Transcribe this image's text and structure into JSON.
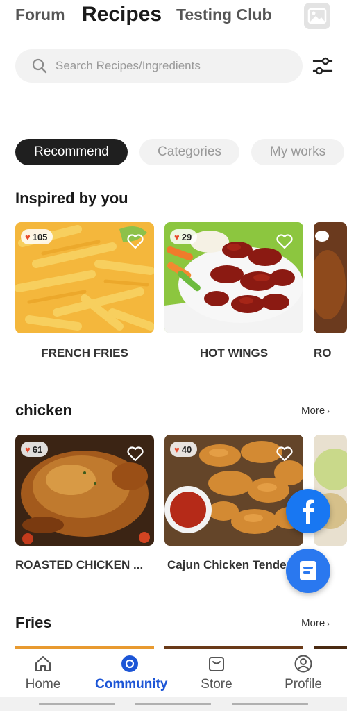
{
  "top_tabs": [
    "Forum",
    "Recipes",
    "Testing Club"
  ],
  "search": {
    "placeholder": "Search Recipes/Ingredients"
  },
  "filter_pills": [
    "Recommend",
    "Categories",
    "My works"
  ],
  "sections": [
    {
      "title": "Inspired by you",
      "items": [
        {
          "label": "FRENCH FRIES",
          "likes": "105"
        },
        {
          "label": "HOT WINGS",
          "likes": "29"
        },
        {
          "label": "RO"
        }
      ]
    },
    {
      "title": "chicken",
      "more": "More",
      "items": [
        {
          "label": "ROASTED CHICKEN ...",
          "likes": "61"
        },
        {
          "label": "Cajun Chicken Tende",
          "likes": "40"
        }
      ]
    },
    {
      "title": "Fries",
      "more": "More"
    }
  ],
  "bottom_nav": [
    {
      "label": "Home",
      "icon": "home-icon"
    },
    {
      "label": "Community",
      "icon": "community-icon",
      "active": true
    },
    {
      "label": "Store",
      "icon": "store-icon"
    },
    {
      "label": "Profile",
      "icon": "profile-icon"
    }
  ],
  "colors": {
    "accent": "#1c55d6",
    "facebook": "#1877f2",
    "heart": "#e84a2c"
  }
}
